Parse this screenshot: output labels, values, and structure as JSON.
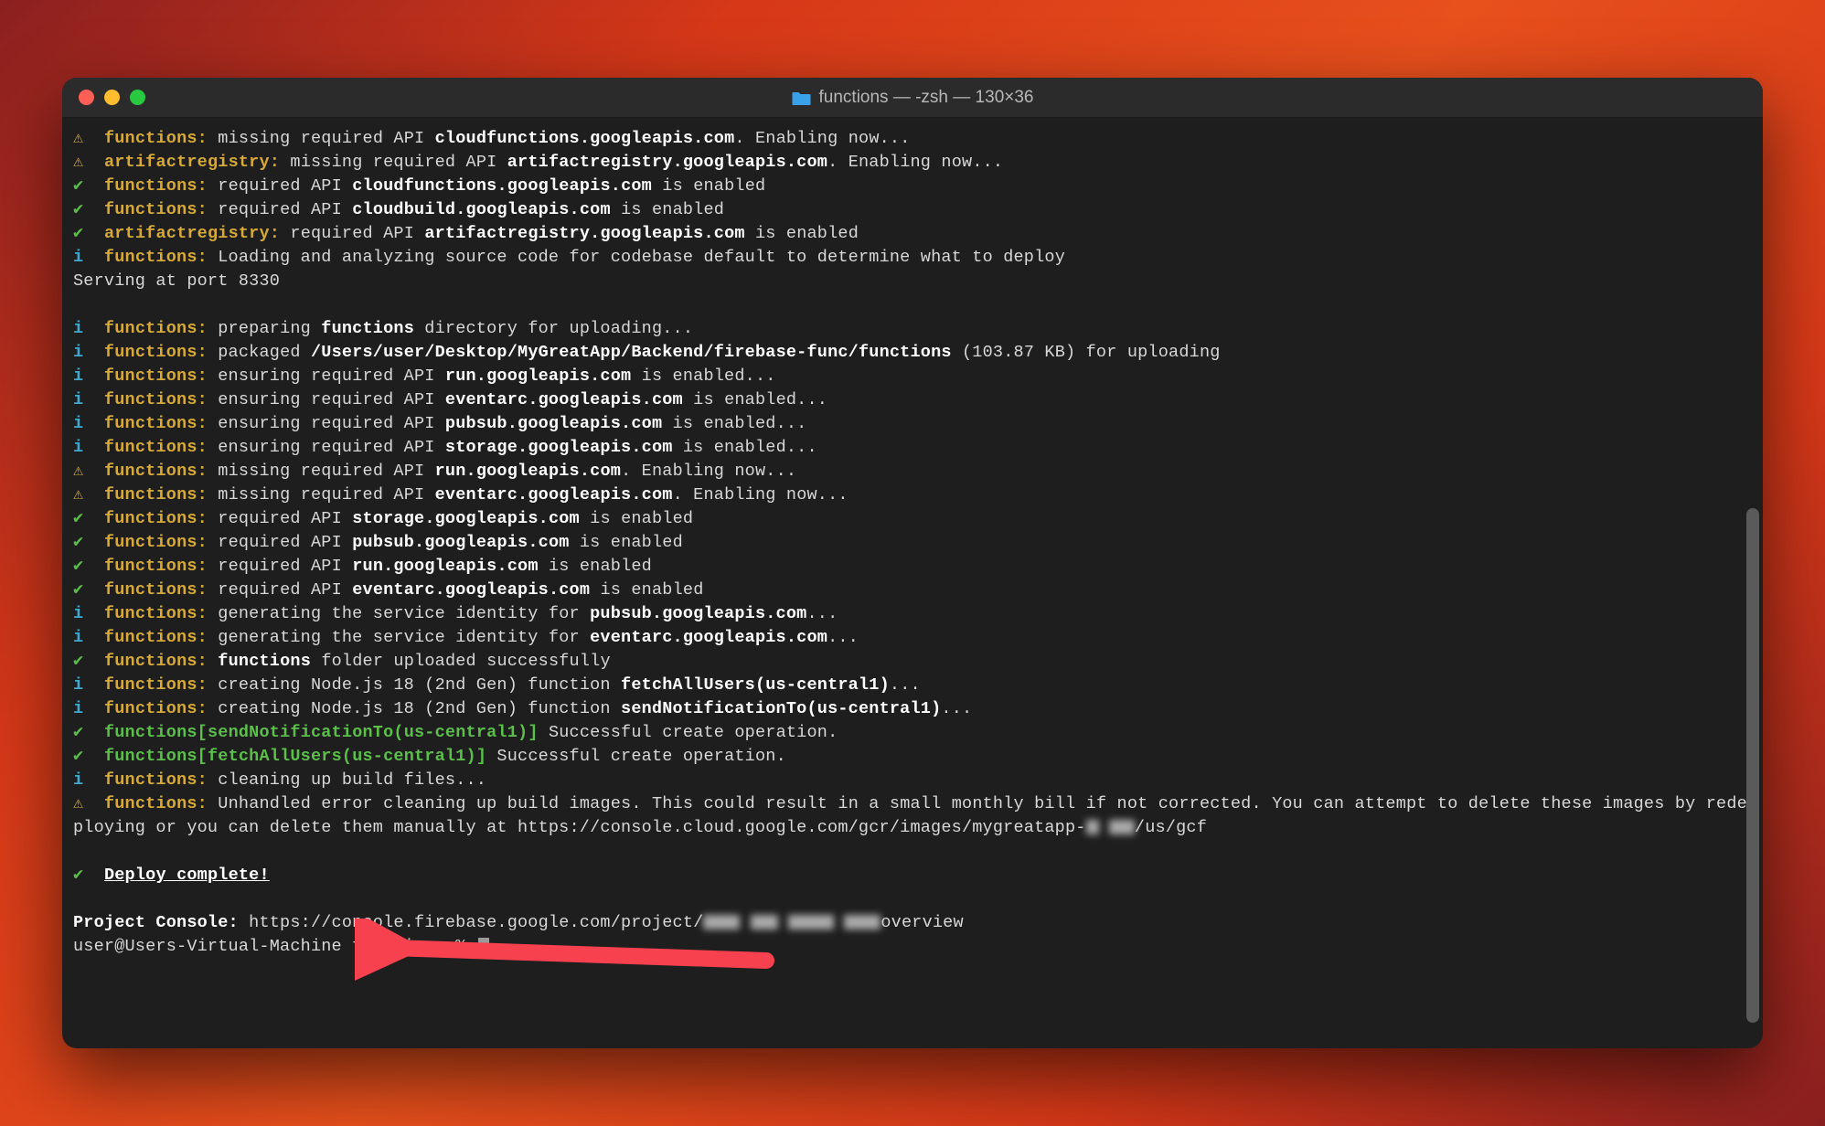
{
  "window": {
    "title": "functions — -zsh — 130×36"
  },
  "lines": [
    {
      "sym": "warn",
      "scope": "functions:",
      "segs": [
        [
          " missing required API ",
          0
        ],
        [
          "cloudfunctions.googleapis.com",
          1
        ],
        [
          ". Enabling now...",
          0
        ]
      ]
    },
    {
      "sym": "warn",
      "scope": "artifactregistry:",
      "segs": [
        [
          " missing required API ",
          0
        ],
        [
          "artifactregistry.googleapis.com",
          1
        ],
        [
          ". Enabling now...",
          0
        ]
      ]
    },
    {
      "sym": "check",
      "scope": "functions:",
      "segs": [
        [
          " required API ",
          0
        ],
        [
          "cloudfunctions.googleapis.com",
          1
        ],
        [
          " is enabled",
          0
        ]
      ]
    },
    {
      "sym": "check",
      "scope": "functions:",
      "segs": [
        [
          " required API ",
          0
        ],
        [
          "cloudbuild.googleapis.com",
          1
        ],
        [
          " is enabled",
          0
        ]
      ]
    },
    {
      "sym": "check",
      "scope": "artifactregistry:",
      "segs": [
        [
          " required API ",
          0
        ],
        [
          "artifactregistry.googleapis.com",
          1
        ],
        [
          " is enabled",
          0
        ]
      ]
    },
    {
      "sym": "info",
      "scope": "functions:",
      "segs": [
        [
          " Loading and analyzing source code for codebase default to determine what to deploy",
          0
        ]
      ]
    },
    {
      "sym": "",
      "scope": "",
      "segs": [
        [
          "Serving at port 8330",
          0
        ]
      ]
    },
    {
      "sym": "blank",
      "scope": "",
      "segs": []
    },
    {
      "sym": "info",
      "scope": "functions:",
      "segs": [
        [
          " preparing ",
          0
        ],
        [
          "functions",
          1
        ],
        [
          " directory for uploading...",
          0
        ]
      ]
    },
    {
      "sym": "info",
      "scope": "functions:",
      "segs": [
        [
          " packaged ",
          0
        ],
        [
          "/Users/user/Desktop/MyGreatApp/Backend/firebase-func/functions",
          1
        ],
        [
          " (103.87 KB) for uploading",
          0
        ]
      ]
    },
    {
      "sym": "info",
      "scope": "functions:",
      "segs": [
        [
          " ensuring required API ",
          0
        ],
        [
          "run.googleapis.com",
          1
        ],
        [
          " is enabled...",
          0
        ]
      ]
    },
    {
      "sym": "info",
      "scope": "functions:",
      "segs": [
        [
          " ensuring required API ",
          0
        ],
        [
          "eventarc.googleapis.com",
          1
        ],
        [
          " is enabled...",
          0
        ]
      ]
    },
    {
      "sym": "info",
      "scope": "functions:",
      "segs": [
        [
          " ensuring required API ",
          0
        ],
        [
          "pubsub.googleapis.com",
          1
        ],
        [
          " is enabled...",
          0
        ]
      ]
    },
    {
      "sym": "info",
      "scope": "functions:",
      "segs": [
        [
          " ensuring required API ",
          0
        ],
        [
          "storage.googleapis.com",
          1
        ],
        [
          " is enabled...",
          0
        ]
      ]
    },
    {
      "sym": "warn",
      "scope": "functions:",
      "segs": [
        [
          " missing required API ",
          0
        ],
        [
          "run.googleapis.com",
          1
        ],
        [
          ". Enabling now...",
          0
        ]
      ]
    },
    {
      "sym": "warn",
      "scope": "functions:",
      "segs": [
        [
          " missing required API ",
          0
        ],
        [
          "eventarc.googleapis.com",
          1
        ],
        [
          ". Enabling now...",
          0
        ]
      ]
    },
    {
      "sym": "check",
      "scope": "functions:",
      "segs": [
        [
          " required API ",
          0
        ],
        [
          "storage.googleapis.com",
          1
        ],
        [
          " is enabled",
          0
        ]
      ]
    },
    {
      "sym": "check",
      "scope": "functions:",
      "segs": [
        [
          " required API ",
          0
        ],
        [
          "pubsub.googleapis.com",
          1
        ],
        [
          " is enabled",
          0
        ]
      ]
    },
    {
      "sym": "check",
      "scope": "functions:",
      "segs": [
        [
          " required API ",
          0
        ],
        [
          "run.googleapis.com",
          1
        ],
        [
          " is enabled",
          0
        ]
      ]
    },
    {
      "sym": "check",
      "scope": "functions:",
      "segs": [
        [
          " required API ",
          0
        ],
        [
          "eventarc.googleapis.com",
          1
        ],
        [
          " is enabled",
          0
        ]
      ]
    },
    {
      "sym": "info",
      "scope": "functions:",
      "segs": [
        [
          " generating the service identity for ",
          0
        ],
        [
          "pubsub.googleapis.com",
          1
        ],
        [
          "...",
          0
        ]
      ]
    },
    {
      "sym": "info",
      "scope": "functions:",
      "segs": [
        [
          " generating the service identity for ",
          0
        ],
        [
          "eventarc.googleapis.com",
          1
        ],
        [
          "...",
          0
        ]
      ]
    },
    {
      "sym": "check",
      "scope": "functions:",
      "segs": [
        [
          " ",
          0
        ],
        [
          "functions",
          1
        ],
        [
          " folder uploaded successfully",
          0
        ]
      ]
    },
    {
      "sym": "info",
      "scope": "functions:",
      "segs": [
        [
          " creating Node.js 18 (2nd Gen) function ",
          0
        ],
        [
          "fetchAllUsers(us-central1)",
          1
        ],
        [
          "...",
          0
        ]
      ]
    },
    {
      "sym": "info",
      "scope": "functions:",
      "segs": [
        [
          " creating Node.js 18 (2nd Gen) function ",
          0
        ],
        [
          "sendNotificationTo(us-central1)",
          1
        ],
        [
          "...",
          0
        ]
      ]
    },
    {
      "sym": "check",
      "scope": "",
      "bracket": "functions[sendNotificationTo(us-central1)]",
      "segs": [
        [
          " Successful create operation.",
          0
        ]
      ]
    },
    {
      "sym": "check",
      "scope": "",
      "bracket": "functions[fetchAllUsers(us-central1)]",
      "segs": [
        [
          " Successful create operation.",
          0
        ]
      ]
    },
    {
      "sym": "info",
      "scope": "functions:",
      "segs": [
        [
          " cleaning up build files...",
          0
        ]
      ]
    },
    {
      "sym": "warn",
      "scope": "functions:",
      "segs": [
        [
          " Unhandled error cleaning up build images. This could result in a small monthly bill if not corrected. You can attempt to delete these images by redeploying or you can delete them manually at https://console.cloud.google.com/gcr/images/mygreatapp-",
          0
        ]
      ],
      "redact_tail": true,
      "tail_after": "/us/gcf"
    },
    {
      "sym": "blank",
      "scope": "",
      "segs": []
    }
  ],
  "deploy_complete": "Deploy complete!",
  "footer": {
    "console_label": "Project Console:",
    "console_url_prefix": " https://console.firebase.google.com/project/",
    "console_url_suffix": "overview",
    "prompt": "user@Users-Virtual-Machine functions % "
  },
  "symbols": {
    "warn": "⚠",
    "check": "✔",
    "info": "i"
  },
  "colors": {
    "bg": "#1e1e1e",
    "scope": "#d6a938",
    "check": "#5bbf4a",
    "info": "#3fa8cc",
    "bold": "#ffffff"
  },
  "arrow": {
    "color": "#f7414f"
  }
}
